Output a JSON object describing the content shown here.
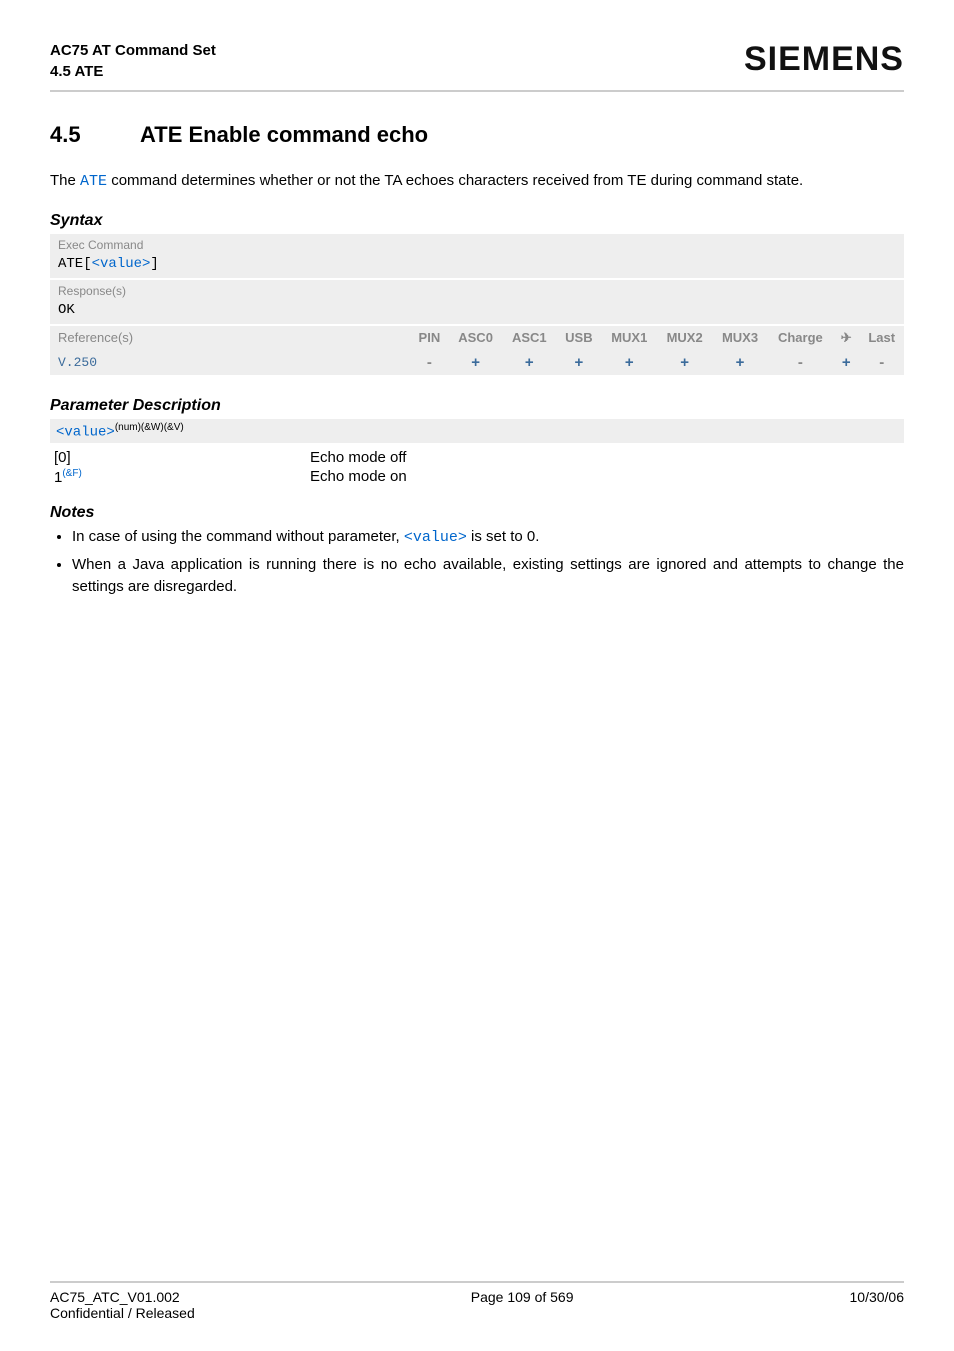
{
  "header": {
    "title": "AC75 AT Command Set",
    "subtitle": "4.5 ATE",
    "brand": "SIEMENS"
  },
  "section": {
    "number": "4.5",
    "title": "ATE   Enable command echo"
  },
  "intro": {
    "pre": "The ",
    "cmd": "ATE",
    "post": " command determines whether or not the TA echoes characters received from TE during command state."
  },
  "syntax": {
    "heading": "Syntax",
    "exec_label": "Exec Command",
    "exec_cmd_pre": "ATE[",
    "exec_cmd_param": "<value>",
    "exec_cmd_post": "]",
    "resp_label": "Response(s)",
    "resp_value": "OK"
  },
  "reftable": {
    "ref_label": "Reference(s)",
    "ref_value": "V.250",
    "cols": [
      "PIN",
      "ASC0",
      "ASC1",
      "USB",
      "MUX1",
      "MUX2",
      "MUX3",
      "Charge",
      "✈",
      "Last"
    ],
    "vals": [
      "-",
      "+",
      "+",
      "+",
      "+",
      "+",
      "+",
      "-",
      "+",
      "-"
    ]
  },
  "paramdesc": {
    "heading": "Parameter Description",
    "tag_name": "<value>",
    "tag_sup": "(num)(&W)(&V)",
    "rows": [
      {
        "k": "[0]",
        "sup": "",
        "v": "Echo mode off"
      },
      {
        "k": "1",
        "sup": "(&F)",
        "v": "Echo mode on"
      }
    ]
  },
  "notes": {
    "heading": "Notes",
    "items_pre0": "In case of using the command without parameter, ",
    "items_code0": "<value>",
    "items_post0": " is set to 0.",
    "item1": "When a Java application is running there is no echo available, existing settings are ignored and attempts to change the settings are disregarded."
  },
  "footer": {
    "left1": "AC75_ATC_V01.002",
    "left2": "Confidential / Released",
    "center": "Page 109 of 569",
    "right": "10/30/06"
  }
}
